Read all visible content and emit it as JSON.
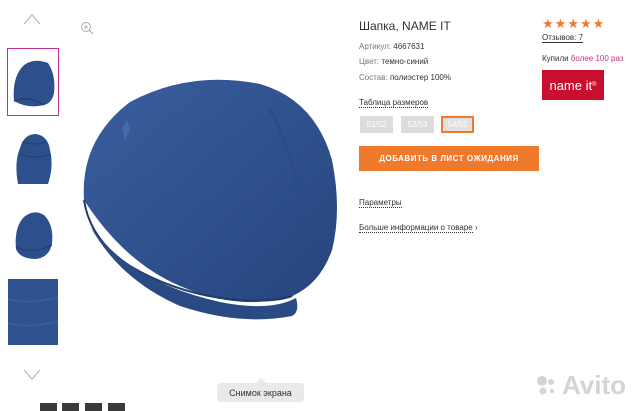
{
  "product": {
    "title": "Шапка, NAME IT",
    "article_label": "Артикул:",
    "article_value": "4667631",
    "color_label": "Цвет:",
    "color_value": "темно-синий",
    "composition_label": "Состав:",
    "composition_value": "полиэстер 100%"
  },
  "sizes": {
    "table_link": "Таблица размеров",
    "options": [
      "51/52",
      "52/53",
      "54/55"
    ],
    "selected": "54/55"
  },
  "actions": {
    "wishlist_button": "ДОБАВИТЬ В ЛИСТ ОЖИДАНИЯ",
    "params_link": "Параметры",
    "more_info_link": "Больше информации о товаре",
    "more_info_arrow": "›"
  },
  "rating": {
    "stars": 5,
    "reviews_text": "Отзывов: 7",
    "bought_prefix": "Купили ",
    "bought_highlight": "более 100 раз"
  },
  "brand": {
    "logo_text": "name it",
    "logo_mark": "®"
  },
  "overlay": {
    "tooltip": "Снимок экрана",
    "watermark": "Avito"
  },
  "colors": {
    "accent": "#f07a2c",
    "highlight": "#c3318d",
    "brand": "#c8102e",
    "hat": "#2d4f8c"
  },
  "icons": {
    "zoom": "zoom-icon",
    "up": "chevron-up-icon",
    "down": "chevron-down-icon",
    "star": "star-icon"
  }
}
